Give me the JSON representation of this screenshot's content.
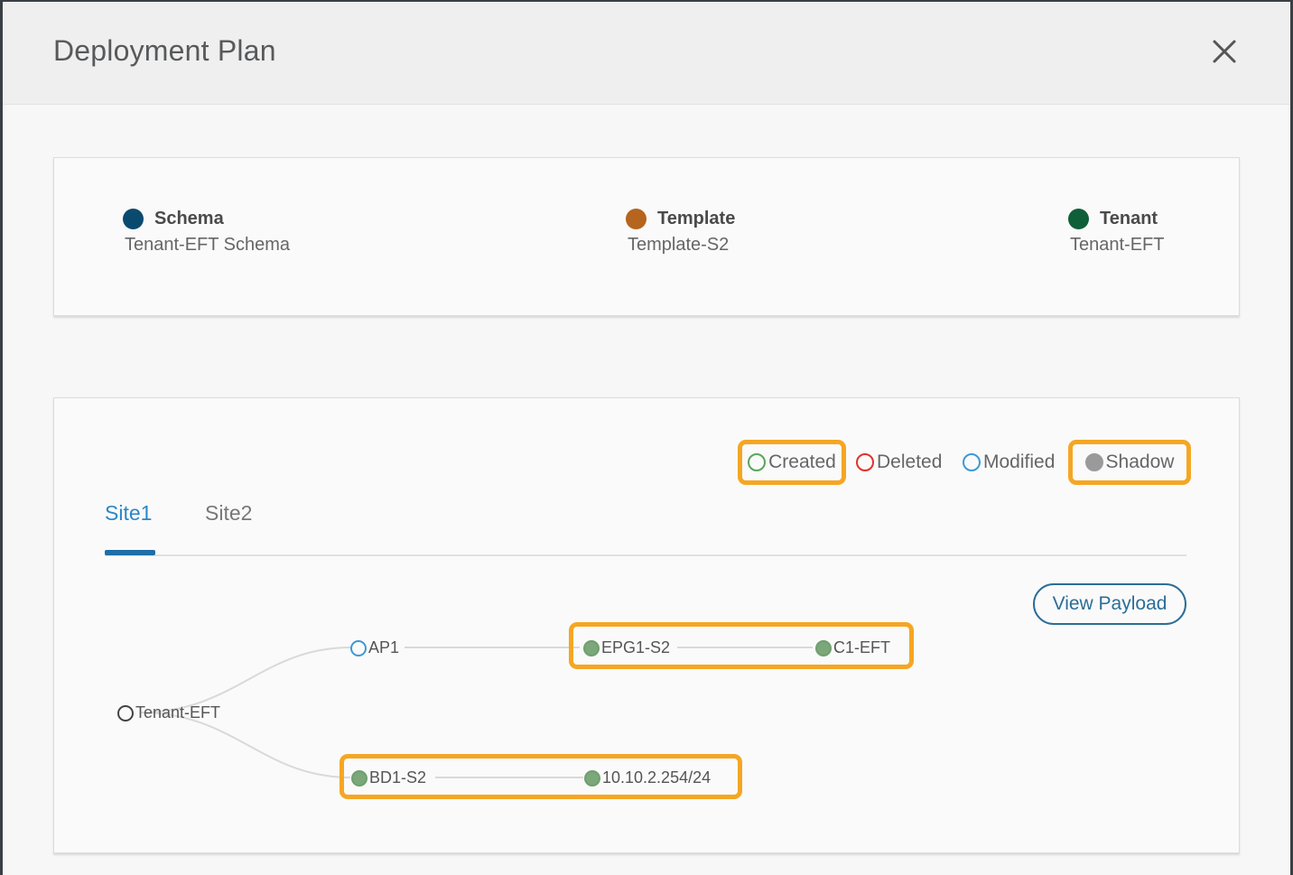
{
  "modal": {
    "title": "Deployment Plan",
    "close_icon": "close-icon"
  },
  "info": {
    "schema": {
      "label": "Schema",
      "value": "Tenant-EFT Schema",
      "color": "#0b4a6f"
    },
    "template": {
      "label": "Template",
      "value": "Template-S2",
      "color": "#b5651d"
    },
    "tenant": {
      "label": "Tenant",
      "value": "Tenant-EFT",
      "color": "#0f5f38"
    }
  },
  "legend": {
    "created": {
      "label": "Created",
      "color": "#5aa55a"
    },
    "deleted": {
      "label": "Deleted",
      "color": "#e0322c"
    },
    "modified": {
      "label": "Modified",
      "color": "#3c9ad6"
    },
    "shadow": {
      "label": "Shadow",
      "color": "#9a9a9a"
    },
    "highlight_color": "#f5a623"
  },
  "tabs": [
    {
      "label": "Site1",
      "active": true
    },
    {
      "label": "Site2",
      "active": false
    }
  ],
  "view_payload_label": "View Payload",
  "graph": {
    "tenant": "Tenant-EFT",
    "ap": "AP1",
    "epg": "EPG1-S2",
    "contract": "C1-EFT",
    "bd": "BD1-S2",
    "subnet": "10.10.2.254/24"
  }
}
